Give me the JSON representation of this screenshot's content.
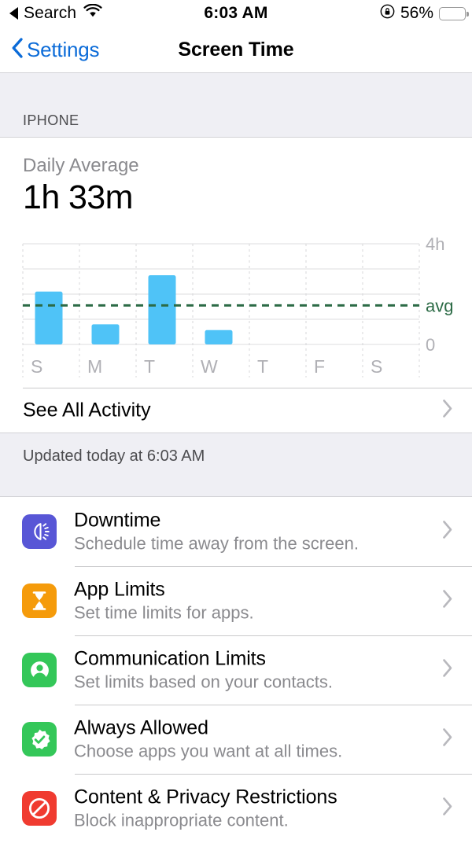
{
  "status_bar": {
    "back_label": "Search",
    "back_icon": "triangle-left-icon",
    "wifi_icon": "wifi-icon",
    "time": "6:03 AM",
    "orientation_lock_icon": "rotation-lock-icon",
    "battery_percent": "56%",
    "battery_level": 56,
    "battery_color": "#c77b17"
  },
  "navbar": {
    "back_label": "Settings",
    "back_icon": "chevron-left-icon",
    "title": "Screen Time",
    "tint_color": "#0b6bd8"
  },
  "device_section": {
    "header": "IPHONE"
  },
  "summary": {
    "daily_average_label": "Daily Average",
    "daily_average_value": "1h 33m",
    "see_all_activity": "See All Activity",
    "chevron_icon": "chevron-right-icon",
    "updated_text": "Updated today at 6:03 AM"
  },
  "chart_data": {
    "type": "bar",
    "title": "Daily Average",
    "categories": [
      "S",
      "M",
      "T",
      "W",
      "T",
      "F",
      "S"
    ],
    "values": [
      2.1,
      0.8,
      2.75,
      0.57,
      0,
      0,
      0
    ],
    "value_unit": "hours",
    "ylim": [
      0,
      4
    ],
    "ytick_labels": [
      "0",
      "4h"
    ],
    "ytick_values": [
      0,
      4
    ],
    "gridlines": [
      0,
      1,
      2,
      3,
      4
    ],
    "average_line": {
      "label": "avg",
      "value": 1.55,
      "color": "#2c6b46",
      "style": "dashed"
    },
    "bar_color": "#4fc3f7",
    "grid": true,
    "xlabel": "",
    "ylabel": "",
    "legend": "none"
  },
  "settings_rows": [
    {
      "title": "Downtime",
      "subtitle": "Schedule time away from the screen.",
      "icon": "downtime-icon",
      "icon_color": "#5856d6",
      "chevron_icon": "chevron-right-icon"
    },
    {
      "title": "App Limits",
      "subtitle": "Set time limits for apps.",
      "icon": "hourglass-icon",
      "icon_color": "#f59b0b",
      "chevron_icon": "chevron-right-icon"
    },
    {
      "title": "Communication Limits",
      "subtitle": "Set limits based on your contacts.",
      "icon": "person-circle-icon",
      "icon_color": "#34c759",
      "chevron_icon": "chevron-right-icon"
    },
    {
      "title": "Always Allowed",
      "subtitle": "Choose apps you want at all times.",
      "icon": "checkmark-seal-icon",
      "icon_color": "#34c759",
      "chevron_icon": "chevron-right-icon"
    },
    {
      "title": "Content & Privacy Restrictions",
      "subtitle": "Block inappropriate content.",
      "icon": "no-entry-icon",
      "icon_color": "#f03b30",
      "chevron_icon": "chevron-right-icon"
    }
  ]
}
